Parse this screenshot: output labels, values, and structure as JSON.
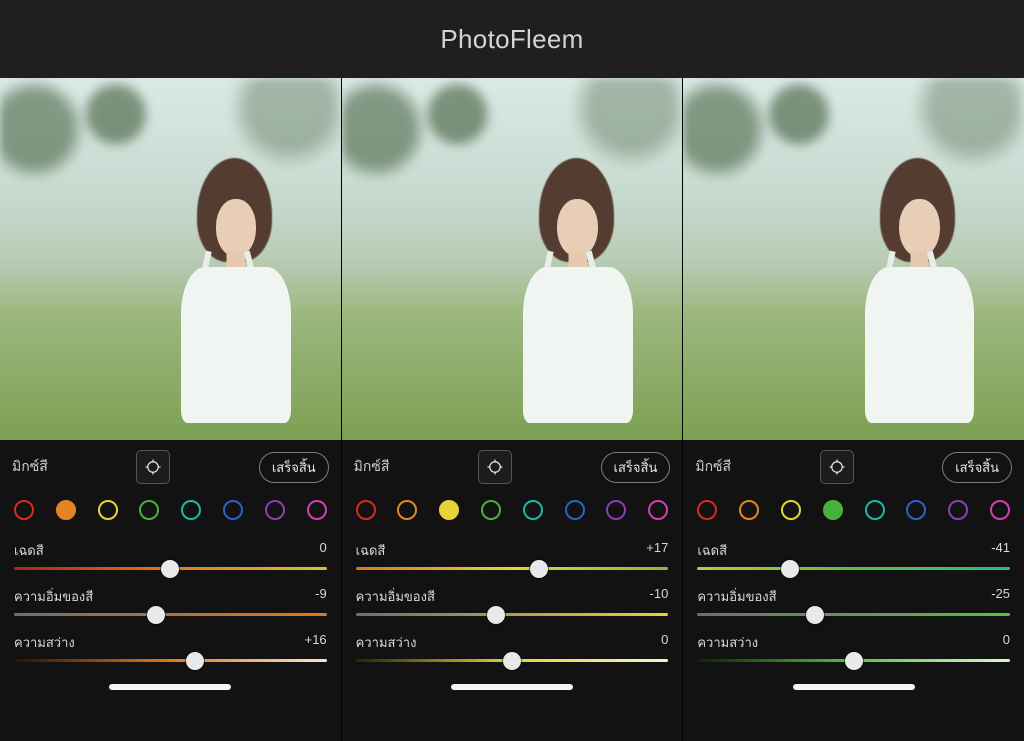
{
  "header": {
    "brand": "PhotoFleem"
  },
  "labels": {
    "mix": "มิกซ์สี",
    "done": "เสร็จสิ้น",
    "hue": "เฉดสี",
    "saturation": "ความอิ่มของสี",
    "luminance": "ความสว่าง"
  },
  "swatch_colors": [
    "#d62b20",
    "#e58424",
    "#e7d338",
    "#46b23a",
    "#1fb7a6",
    "#2b62c7",
    "#8a3fb3",
    "#d13fb0"
  ],
  "panels": [
    {
      "selected_index": 1,
      "accent": "#e58424",
      "gradients": {
        "hue": "grad-orange-hue",
        "sat": "grad-orange-sat",
        "lum": "grad-orange-lum"
      },
      "sliders": {
        "hue": 0,
        "saturation": -9,
        "luminance": 16
      },
      "display": {
        "hue": "0",
        "saturation": "-9",
        "luminance": "+16"
      }
    },
    {
      "selected_index": 2,
      "accent": "#e7d338",
      "gradients": {
        "hue": "grad-yellow-hue",
        "sat": "grad-yellow-sat",
        "lum": "grad-yellow-lum"
      },
      "sliders": {
        "hue": 17,
        "saturation": -10,
        "luminance": 0
      },
      "display": {
        "hue": "+17",
        "saturation": "-10",
        "luminance": "0"
      }
    },
    {
      "selected_index": 3,
      "accent": "#46b23a",
      "gradients": {
        "hue": "grad-green-hue",
        "sat": "grad-green-sat",
        "lum": "grad-green-lum"
      },
      "sliders": {
        "hue": -41,
        "saturation": -25,
        "luminance": 0
      },
      "display": {
        "hue": "-41",
        "saturation": "-25",
        "luminance": "0"
      }
    }
  ]
}
